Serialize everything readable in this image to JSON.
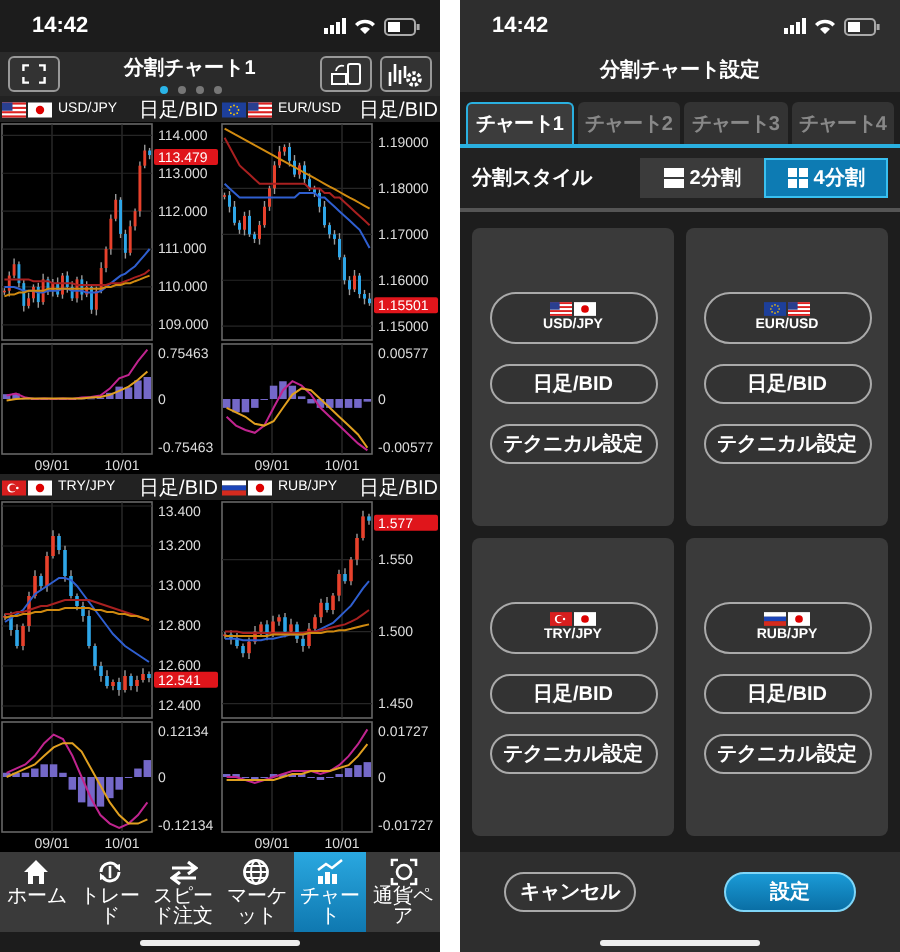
{
  "chart_screen": {
    "status_time": "14:42",
    "title": "分割チャート1",
    "page_dots": [
      {
        "selected": true
      },
      {
        "selected": false
      },
      {
        "selected": false
      },
      {
        "selected": false
      }
    ],
    "panels": [
      {
        "pair": "USD/JPY",
        "flags": [
          {
            "kind": "us"
          },
          {
            "kind": "jp"
          }
        ],
        "timeframe": "日足/BID",
        "price_axis_labels": [
          "114.000",
          "113.000",
          "112.000",
          "111.000",
          "110.000",
          "109.000"
        ],
        "last_price": "113.479",
        "indicator_axis_labels": [
          "0.75463",
          "0",
          "-0.75463"
        ],
        "date_labels": [
          "09/01",
          "10/01"
        ]
      },
      {
        "pair": "EUR/USD",
        "flags": [
          {
            "kind": "eu"
          },
          {
            "kind": "us"
          }
        ],
        "timeframe": "日足/BID",
        "price_axis_labels": [
          "1.19000",
          "1.18000",
          "1.17000",
          "1.16000",
          "1.15000"
        ],
        "last_price": "1.15501",
        "indicator_axis_labels": [
          "0.00577",
          "0",
          "-0.00577"
        ],
        "date_labels": [
          "09/01",
          "10/01"
        ]
      },
      {
        "pair": "TRY/JPY",
        "flags": [
          {
            "kind": "tr"
          },
          {
            "kind": "jp"
          }
        ],
        "timeframe": "日足/BID",
        "price_axis_labels": [
          "13.400",
          "13.200",
          "13.000",
          "12.800",
          "12.600",
          "12.400"
        ],
        "last_price": "12.541",
        "indicator_axis_labels": [
          "0.12134",
          "0",
          "-0.12134"
        ],
        "date_labels": [
          "09/01",
          "10/01"
        ]
      },
      {
        "pair": "RUB/JPY",
        "flags": [
          {
            "kind": "ru"
          },
          {
            "kind": "jp"
          }
        ],
        "timeframe": "日足/BID",
        "price_axis_labels": [
          "1.550",
          "1.500",
          "1.450"
        ],
        "last_price": "1.577",
        "indicator_axis_labels": [
          "0.01727",
          "0",
          "-0.01727"
        ],
        "date_labels": [
          "09/01",
          "10/01"
        ]
      }
    ],
    "tab_bar": [
      {
        "label": "ホーム",
        "selected": false
      },
      {
        "label": "トレード",
        "selected": false
      },
      {
        "label": "スピード注文",
        "selected": false
      },
      {
        "label": "マーケット",
        "selected": false
      },
      {
        "label": "チャート",
        "selected": true
      },
      {
        "label": "通貨ペア",
        "selected": false
      }
    ]
  },
  "settings_screen": {
    "status_time": "14:42",
    "title": "分割チャート設定",
    "tabs": [
      {
        "label": "チャート1",
        "selected": true
      },
      {
        "label": "チャート2",
        "selected": false
      },
      {
        "label": "チャート3",
        "selected": false
      },
      {
        "label": "チャート4",
        "selected": false
      }
    ],
    "split_style": {
      "label": "分割スタイル",
      "options": [
        {
          "label": "2分割",
          "selected": false
        },
        {
          "label": "4分割",
          "selected": true
        }
      ]
    },
    "slots": [
      {
        "pair": "USD/JPY",
        "flags": [
          {
            "kind": "us"
          },
          {
            "kind": "jp"
          }
        ],
        "timeframe": "日足/BID",
        "technical": "テクニカル設定"
      },
      {
        "pair": "EUR/USD",
        "flags": [
          {
            "kind": "eu"
          },
          {
            "kind": "us"
          }
        ],
        "timeframe": "日足/BID",
        "technical": "テクニカル設定"
      },
      {
        "pair": "TRY/JPY",
        "flags": [
          {
            "kind": "tr"
          },
          {
            "kind": "jp"
          }
        ],
        "timeframe": "日足/BID",
        "technical": "テクニカル設定"
      },
      {
        "pair": "RUB/JPY",
        "flags": [
          {
            "kind": "ru"
          },
          {
            "kind": "jp"
          }
        ],
        "timeframe": "日足/BID",
        "technical": "テクニカル設定"
      }
    ],
    "buttons": [
      {
        "label": "キャンセル",
        "kind": "secondary"
      },
      {
        "label": "設定",
        "kind": "primary"
      }
    ]
  }
}
